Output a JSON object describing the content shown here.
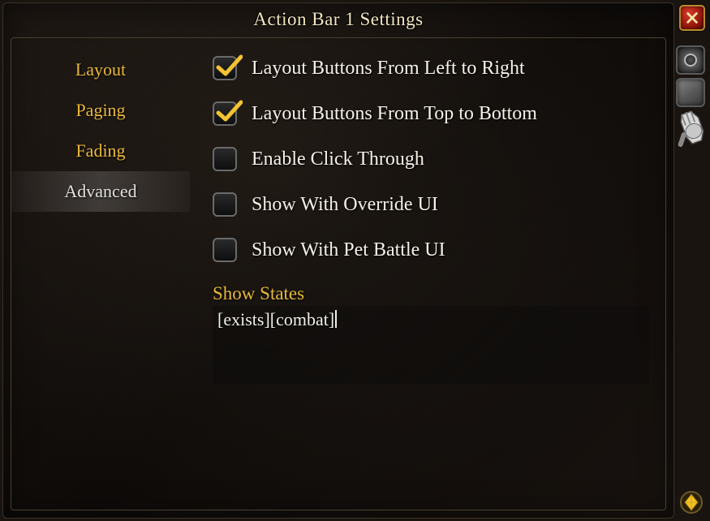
{
  "window": {
    "title": "Action Bar 1 Settings"
  },
  "sidebar": {
    "items": [
      {
        "label": "Layout",
        "active": false
      },
      {
        "label": "Paging",
        "active": false
      },
      {
        "label": "Fading",
        "active": false
      },
      {
        "label": "Advanced",
        "active": true
      }
    ]
  },
  "options": [
    {
      "label": "Layout Buttons From Left to Right",
      "checked": true
    },
    {
      "label": "Layout Buttons From Top to Bottom",
      "checked": true
    },
    {
      "label": "Enable Click Through",
      "checked": false
    },
    {
      "label": "Show With Override UI",
      "checked": false
    },
    {
      "label": "Show With Pet Battle UI",
      "checked": false
    }
  ],
  "show_states": {
    "label": "Show States",
    "value": "[exists][combat]"
  },
  "colors": {
    "accent": "#e9b83a",
    "text": "#f5f1e8",
    "close_bg": "#b81f12",
    "close_border": "#b88b2e"
  }
}
